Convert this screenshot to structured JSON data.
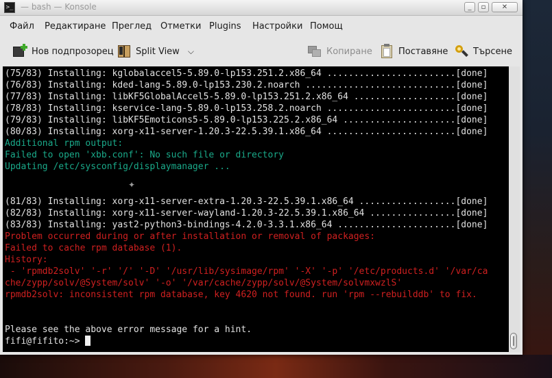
{
  "window": {
    "title": "— bash — Konsole",
    "app_icon": "terminal-icon",
    "controls": [
      "minimize",
      "maximize",
      "close"
    ]
  },
  "menubar": {
    "items": [
      "Файл",
      "Редактиране",
      "Преглед",
      "Отметки",
      "Plugins",
      "Настройки",
      "Помощ"
    ]
  },
  "toolbar": {
    "new_tab": {
      "label": "Нов подпрозорец",
      "icon": "new-tab-icon"
    },
    "split_view": {
      "label": "Split View",
      "icon": "split-view-icon"
    },
    "copy": {
      "label": "Копиране",
      "icon": "copy-icon",
      "enabled": false
    },
    "paste": {
      "label": "Поставяне",
      "icon": "paste-icon"
    },
    "find": {
      "label": "Търсене",
      "icon": "search-icon"
    }
  },
  "terminal": {
    "lines": [
      {
        "text": "(75/83) Installing: kglobalaccel5-5.89.0-lp153.251.2.x86_64 ........................[done]",
        "color": "white"
      },
      {
        "text": "(76/83) Installing: kded-lang-5.89.0-lp153.230.2.noarch ............................[done]",
        "color": "white"
      },
      {
        "text": "(77/83) Installing: libKF5GlobalAccel5-5.89.0-lp153.251.2.x86_64 ...................[done]",
        "color": "white"
      },
      {
        "text": "(78/83) Installing: kservice-lang-5.89.0-lp153.258.2.noarch ........................[done]",
        "color": "white"
      },
      {
        "text": "(79/83) Installing: libKF5Emoticons5-5.89.0-lp153.225.2.x86_64 .....................[done]",
        "color": "white"
      },
      {
        "text": "(80/83) Installing: xorg-x11-server-1.20.3-22.5.39.1.x86_64 ........................[done]",
        "color": "white"
      },
      {
        "text": "Additional rpm output:",
        "color": "cyan"
      },
      {
        "text": "Failed to open 'xbb.conf': No such file or directory",
        "color": "cyan"
      },
      {
        "text": "Updating /etc/sysconfig/displaymanager ...",
        "color": "cyan"
      },
      {
        "text": "",
        "color": "white"
      },
      {
        "text": "",
        "color": "white"
      },
      {
        "text": "(81/83) Installing: xorg-x11-server-extra-1.20.3-22.5.39.1.x86_64 ..................[done]",
        "color": "white"
      },
      {
        "text": "(82/83) Installing: xorg-x11-server-wayland-1.20.3-22.5.39.1.x86_64 ................[done]",
        "color": "white"
      },
      {
        "text": "(83/83) Installing: yast2-python3-bindings-4.2.0-3.3.1.x86_64 ......................[done]",
        "color": "white"
      },
      {
        "text": "Problem occurred during or after installation or removal of packages:",
        "color": "red"
      },
      {
        "text": "Failed to cache rpm database (1).",
        "color": "red"
      },
      {
        "text": "History:",
        "color": "red"
      },
      {
        "text": " - 'rpmdb2solv' '-r' '/' '-D' '/usr/lib/sysimage/rpm' '-X' '-p' '/etc/products.d' '/var/ca",
        "color": "red"
      },
      {
        "text": "che/zypp/solv/@System/solv' '-o' '/var/cache/zypp/solv/@System/solvmxwzlS'",
        "color": "red"
      },
      {
        "text": "rpmdb2solv: inconsistent rpm database, key 4620 not found. run 'rpm --rebuilddb' to fix.",
        "color": "red"
      },
      {
        "text": "",
        "color": "white"
      },
      {
        "text": "",
        "color": "white"
      },
      {
        "text": "Please see the above error message for a hint.",
        "color": "white"
      }
    ],
    "prompt": "fifi@fifito:~> ",
    "colors": {
      "white": "#e2e2e2",
      "cyan": "#1aaa8a",
      "red": "#d02020"
    }
  }
}
